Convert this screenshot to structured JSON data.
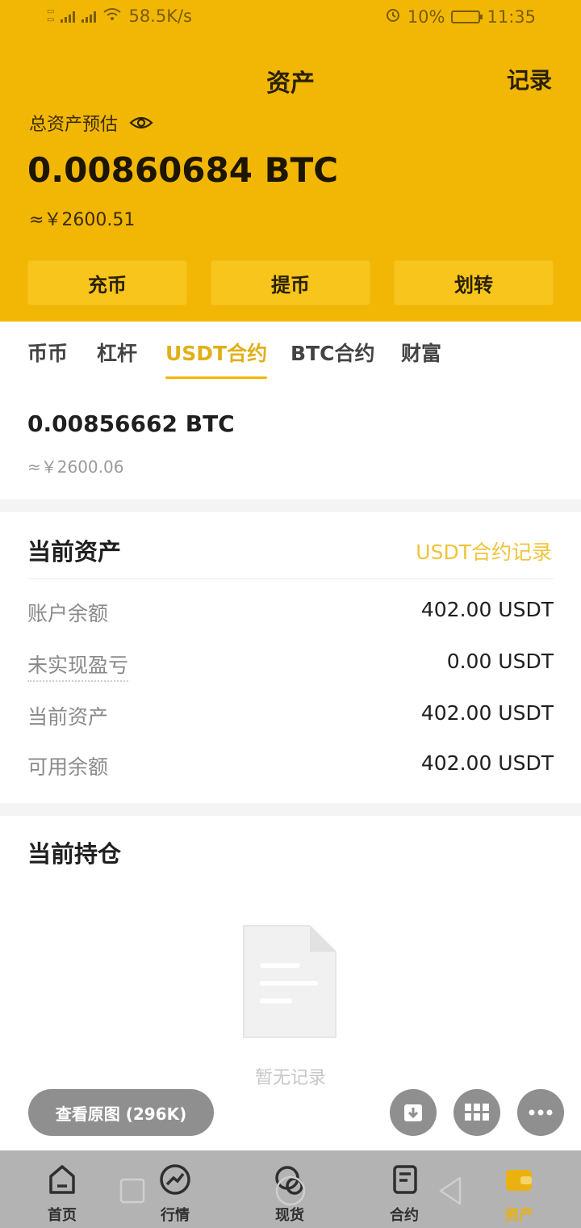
{
  "status_bar": {
    "network_speed": "58.5K/s",
    "battery": "10%",
    "time": "11:35"
  },
  "header": {
    "title": "资产",
    "record_link": "记录",
    "total_label": "总资产预估",
    "total_btc": "0.00860684 BTC",
    "total_cny": "≈￥2600.51",
    "actions": [
      "充币",
      "提币",
      "划转"
    ]
  },
  "tabs": {
    "items": [
      "币币",
      "杠杆",
      "USDT合约",
      "BTC合约",
      "财富"
    ],
    "active": "USDT合约"
  },
  "account": {
    "btc": "0.00856662 BTC",
    "cny": "≈￥2600.06"
  },
  "current_assets": {
    "title": "当前资产",
    "link": "USDT合约记录",
    "rows": [
      {
        "label": "账户余额",
        "value": "402.00 USDT"
      },
      {
        "label": "未实现盈亏",
        "value": "0.00 USDT"
      },
      {
        "label": "当前资产",
        "value": "402.00 USDT"
      },
      {
        "label": "可用余额",
        "value": "402.00 USDT"
      }
    ]
  },
  "positions": {
    "title": "当前持仓",
    "empty_text": "暂无记录"
  },
  "image_viewer": {
    "view_original": "查看原图 (296K)"
  },
  "bottom_nav": {
    "items": [
      "首页",
      "行情",
      "现货",
      "合约",
      "资产"
    ],
    "active": "资产"
  },
  "colors": {
    "brand_yellow": "#f2b705",
    "accent_text": "#e0b017"
  }
}
